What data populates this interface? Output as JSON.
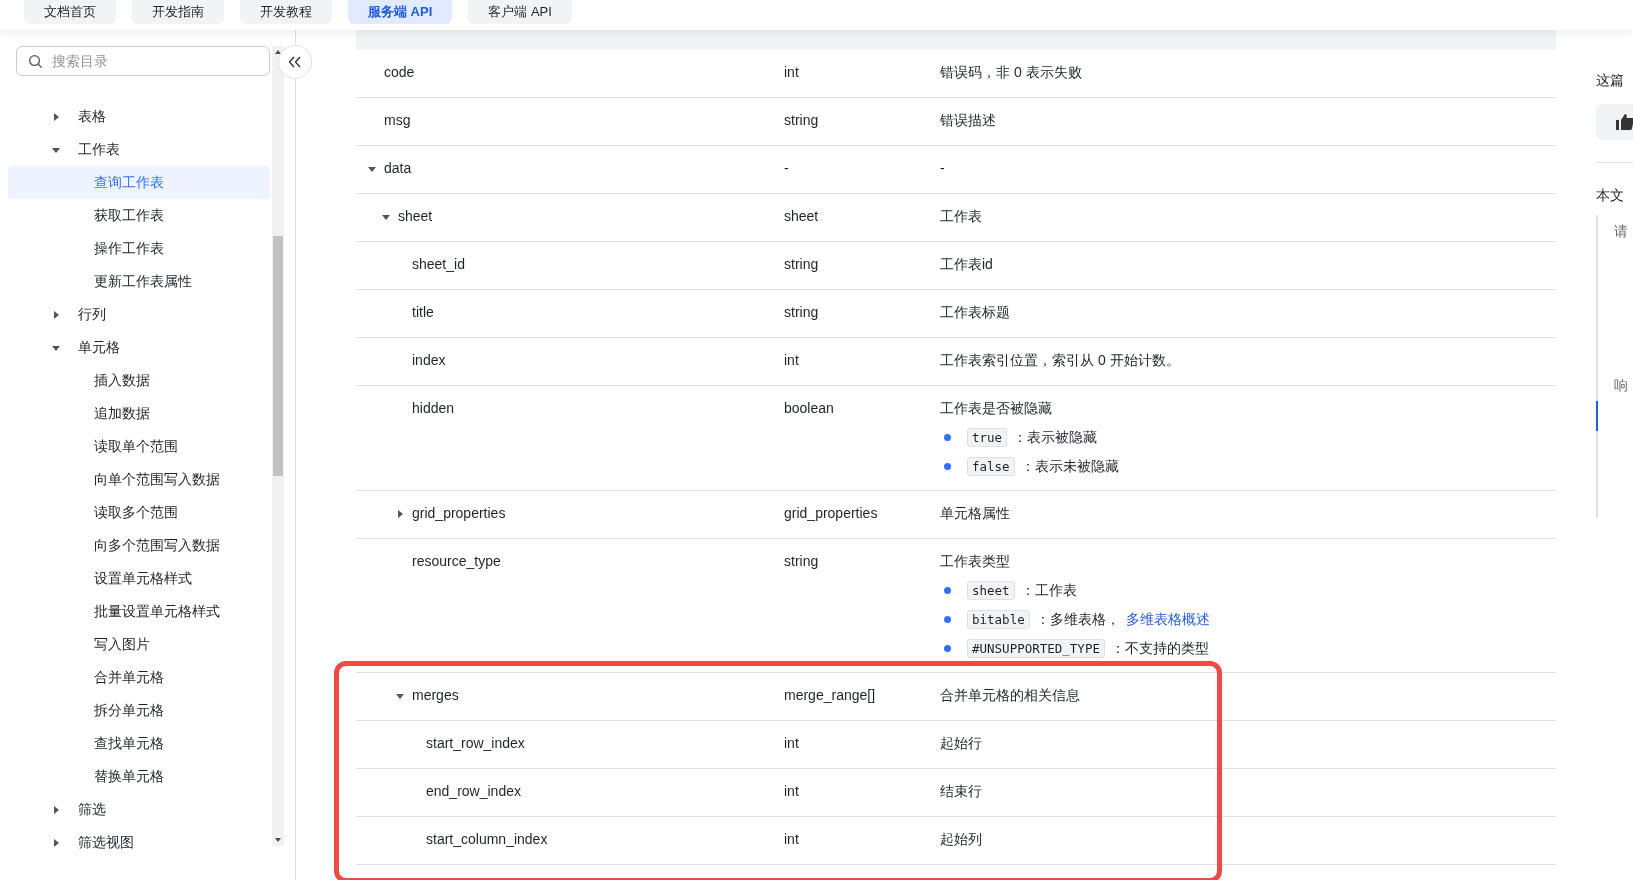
{
  "top_tabs": [
    {
      "label": "文档首页",
      "selected": false
    },
    {
      "label": "开发指南",
      "selected": false
    },
    {
      "label": "开发教程",
      "selected": false
    },
    {
      "label": "服务端 API",
      "selected": true
    },
    {
      "label": "客户端 API",
      "selected": false
    }
  ],
  "sidebar": {
    "search": {
      "placeholder": "搜索目录"
    },
    "items": [
      {
        "label": "表格",
        "expanded": false,
        "selected": false
      },
      {
        "label": "工作表",
        "expanded": true,
        "selected": false,
        "children": [
          {
            "label": "查询工作表",
            "selected": true
          },
          {
            "label": "获取工作表",
            "selected": false
          },
          {
            "label": "操作工作表",
            "selected": false
          },
          {
            "label": "更新工作表属性",
            "selected": false
          }
        ]
      },
      {
        "label": "行列",
        "expanded": false,
        "selected": false
      },
      {
        "label": "单元格",
        "expanded": true,
        "selected": false,
        "children": [
          {
            "label": "插入数据",
            "selected": false
          },
          {
            "label": "追加数据",
            "selected": false
          },
          {
            "label": "读取单个范围",
            "selected": false
          },
          {
            "label": "向单个范围写入数据",
            "selected": false
          },
          {
            "label": "读取多个范围",
            "selected": false
          },
          {
            "label": "向多个范围写入数据",
            "selected": false
          },
          {
            "label": "设置单元格样式",
            "selected": false
          },
          {
            "label": "批量设置单元格样式",
            "selected": false
          },
          {
            "label": "写入图片",
            "selected": false
          },
          {
            "label": "合并单元格",
            "selected": false
          },
          {
            "label": "拆分单元格",
            "selected": false
          },
          {
            "label": "查找单元格",
            "selected": false
          },
          {
            "label": "替换单元格",
            "selected": false
          }
        ]
      },
      {
        "label": "筛选",
        "expanded": false,
        "selected": false
      },
      {
        "label": "筛选视图",
        "expanded": false,
        "selected": false
      }
    ]
  },
  "table": {
    "rows": [
      {
        "name": "code",
        "type": "int",
        "description": "错误码，非 0 表示失败"
      },
      {
        "name": "msg",
        "type": "string",
        "description": "错误描述"
      },
      {
        "name": "data",
        "type": "-",
        "description": "-",
        "expanded": true,
        "children": [
          {
            "name": "sheet",
            "type": "sheet",
            "description": "工作表",
            "expanded": true,
            "children": [
              {
                "name": "sheet_id",
                "type": "string",
                "description": "工作表id"
              },
              {
                "name": "title",
                "type": "string",
                "description": "工作表标题"
              },
              {
                "name": "index",
                "type": "int",
                "description": "工作表索引位置，索引从 0 开始计数。"
              },
              {
                "name": "hidden",
                "type": "boolean",
                "description": "工作表是否被隐藏",
                "values": [
                  {
                    "code": "true",
                    "text": "：表示被隐藏"
                  },
                  {
                    "code": "false",
                    "text": "：表示未被隐藏"
                  }
                ]
              },
              {
                "name": "grid_properties",
                "type": "grid_properties",
                "description": "单元格属性",
                "expanded": false
              },
              {
                "name": "resource_type",
                "type": "string",
                "description": "工作表类型",
                "values": [
                  {
                    "code": "sheet",
                    "text": "：工作表"
                  },
                  {
                    "code": "bitable",
                    "text": "：多维表格，",
                    "link": "多维表格概述"
                  },
                  {
                    "code": "#UNSUPPORTED_TYPE",
                    "text": "：不支持的类型"
                  }
                ]
              },
              {
                "name": "merges",
                "type": "merge_range[]",
                "description": "合并单元格的相关信息",
                "expanded": true,
                "children": [
                  {
                    "name": "start_row_index",
                    "type": "int",
                    "description": "起始行"
                  },
                  {
                    "name": "end_row_index",
                    "type": "int",
                    "description": "结束行"
                  },
                  {
                    "name": "start_column_index",
                    "type": "int",
                    "description": "起始列"
                  }
                ]
              }
            ]
          }
        ]
      }
    ]
  },
  "right_panel": {
    "feedback_title": "这篇",
    "toc_title": "本文",
    "toc": [
      {
        "label": "请",
        "selected": false
      },
      {
        "label": "响",
        "selected": false
      }
    ]
  }
}
